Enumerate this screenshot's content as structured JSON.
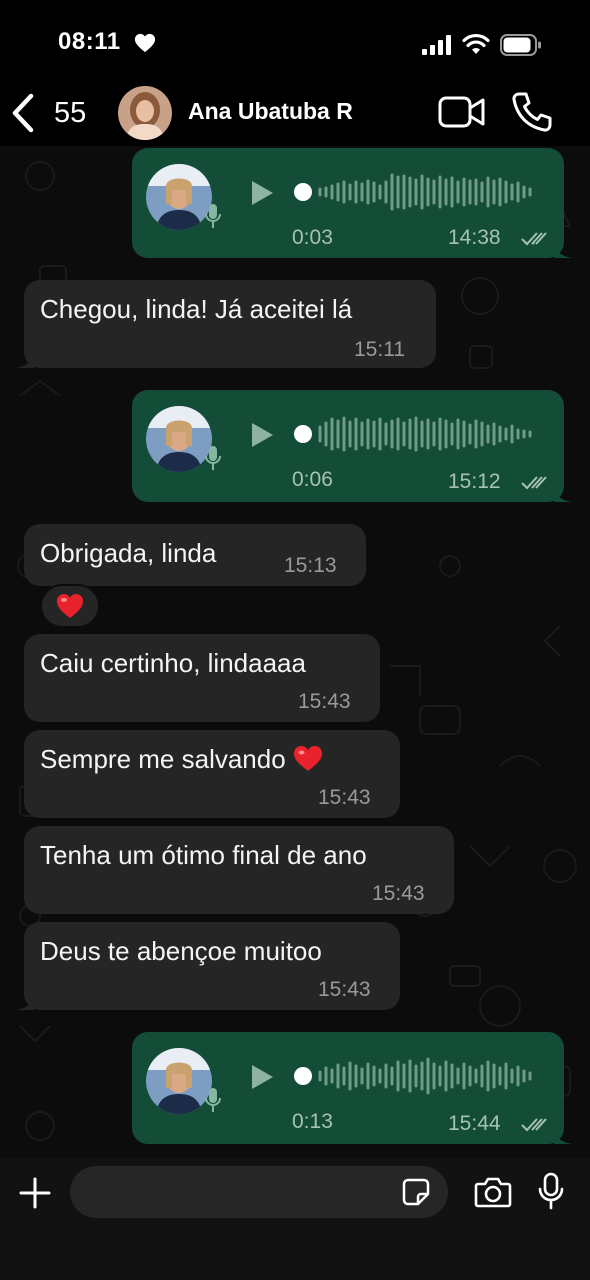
{
  "status_bar": {
    "time": "08:11",
    "battery_level": 0.9
  },
  "header": {
    "back_count": "55",
    "contact_name": "Ana Ubatuba R"
  },
  "messages": [
    {
      "type": "voice",
      "direction": "out",
      "duration": "0:03",
      "time": "14:38",
      "status": "read"
    },
    {
      "type": "text",
      "direction": "in",
      "text": "Chegou, linda! Já aceitei lá",
      "time": "15:11"
    },
    {
      "type": "voice",
      "direction": "out",
      "duration": "0:06",
      "time": "15:12",
      "status": "read"
    },
    {
      "type": "text",
      "direction": "in",
      "text": "Obrigada, linda",
      "time": "15:13",
      "reaction": "heart"
    },
    {
      "type": "text",
      "direction": "in",
      "text": "Caiu certinho, lindaaaa",
      "time": "15:43"
    },
    {
      "type": "text",
      "direction": "in",
      "text": "Sempre me salvando",
      "emoji": "heart",
      "time": "15:43"
    },
    {
      "type": "text",
      "direction": "in",
      "text": "Tenha um ótimo final de ano",
      "time": "15:43"
    },
    {
      "type": "text",
      "direction": "in",
      "text": "Deus te abençoe muitoo",
      "time": "15:43"
    },
    {
      "type": "voice",
      "direction": "out",
      "duration": "0:13",
      "time": "15:44",
      "status": "read"
    }
  ],
  "input": {
    "placeholder": ""
  },
  "colors": {
    "outgoing_bubble": "#144d37",
    "incoming_bubble": "#252525",
    "background": "#0c0c0c"
  },
  "icons": [
    "back-chevron-icon",
    "video-call-icon",
    "phone-icon",
    "play-icon",
    "mic-icon",
    "read-ticks-icon",
    "heart-icon",
    "plus-icon",
    "sticker-icon",
    "camera-icon"
  ]
}
